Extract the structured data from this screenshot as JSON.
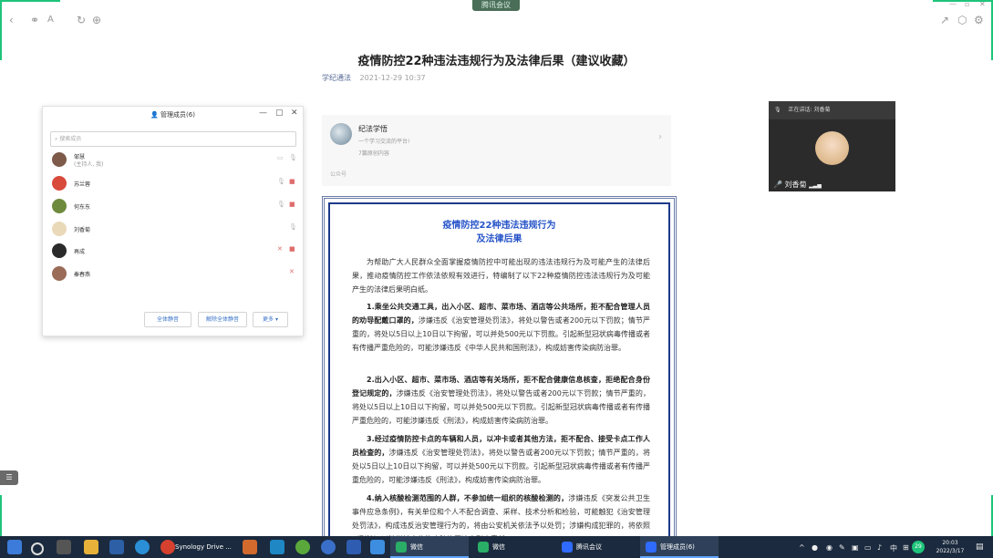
{
  "browser": {
    "meeting_caption": "腾讯会议",
    "icons": [
      "back-icon",
      "link-icon",
      "font-size-icon",
      "refresh-icon",
      "globe-icon",
      "share-icon",
      "cube-icon",
      "settings-icon"
    ]
  },
  "article": {
    "title": "疫情防控22种违法违规行为及法律后果（建议收藏）",
    "account": "学纪通法",
    "date": "2021-12-29 10:37"
  },
  "member_panel": {
    "title": "管理成员(6)",
    "search_placeholder": "搜索成员",
    "members": [
      {
        "name": "邹慧",
        "sub": "(主持人, 我)",
        "avatar_color": "#7d5a4a"
      },
      {
        "name": "苏兰蓉",
        "sub": "",
        "avatar_color": "#d84a3a"
      },
      {
        "name": "何东东",
        "sub": "",
        "avatar_color": "#6e8a3c"
      },
      {
        "name": "刘香菊",
        "sub": "",
        "avatar_color": "#e9d9b8"
      },
      {
        "name": "再成",
        "sub": "",
        "avatar_color": "#2a2a2a"
      },
      {
        "name": "秦春燕",
        "sub": "",
        "avatar_color": "#9a6b57"
      }
    ],
    "buttons": {
      "mute_all": "全体静音",
      "unmute_all": "解除全体静音",
      "more": "更多 ▾"
    }
  },
  "video": {
    "speaking_label": "正在讲话: 刘香菊",
    "name": "刘香菊"
  },
  "account_card": {
    "name": "纪法学悟",
    "desc": "一个学习交流的平台!",
    "count": "7篇原创内容",
    "label": "公众号"
  },
  "notice": {
    "title_line1": "疫情防控22种违法违规行为",
    "title_line2": "及法律后果",
    "intro": "为帮助广大人民群众全面掌握疫情防控中可能出现的违法违规行为及可能产生的法律后果，推动疫情防控工作依法依规有效进行，特编制了以下22种疫情防控违法违规行为及可能产生的法律后果明白纸。",
    "item1_head": "1.乘坐公共交通工具，出入小区、超市、菜市场、酒店等公共场所，拒不配合管理人员的劝导配戴口罩的，",
    "item1_body": "涉嫌违反《治安管理处罚法》，将处以警告或者200元以下罚款；情节严重的，将处以5日以上10日以下拘留，可以并处500元以下罚款。引起新型冠状病毒传播或者有传播严重危险的，可能涉嫌违反《中华人民共和国刑法》，构成妨害传染病防治罪。",
    "item2_head": "2.出入小区、超市、菜市场、酒店等有关场所，拒不配合健康信息核查，拒绝配合身份登记规定的，",
    "item2_body": "涉嫌违反《治安管理处罚法》，将处以警告或者200元以下罚款；情节严重的，将处以5日以上10日以下拘留，可以并处500元以下罚款。引起新型冠状病毒传播或者有传播严重危险的，可能涉嫌违反《刑法》，构成妨害传染病防治罪。",
    "item3_head": "3.经过疫情防控卡点的车辆和人员，以冲卡或者其他方法，拒不配合、接受卡点工作人员检查的，",
    "item3_body": "涉嫌违反《治安管理处罚法》，将处以警告或者200元以下罚款；情节严重的，将处以5日以上10日以下拘留，可以并处500元以下罚款。引起新型冠状病毒传播或者有传播严重危险的，可能涉嫌违反《刑法》，构成妨害传染病防治罪。",
    "item4_head": "4.纳入核酸检测范围的人群，不参加统一组织的核酸检测的，",
    "item4_body": "涉嫌违反《突发公共卫生事件应急条例》，有关单位和个人不配合调查、采样、技术分析和检验，可能触犯《治安管理处罚法》，构成违反治安管理行为的，将由公安机关依法予以处罚；涉嫌构成犯罪的，将依照《刑法》以涉嫌妨害传染病防治罪追究刑事责任。"
  },
  "left_toggle": "☰",
  "taskbar": {
    "apps": [
      {
        "label": "Synology Drive ...",
        "color": "#d6412f"
      },
      {
        "label": "微信",
        "color": "#2aae67"
      },
      {
        "label": "微信",
        "color": "#2aae67"
      },
      {
        "label": "腾讯会议",
        "color": "#2f6bff"
      },
      {
        "label": "管理成员(6)",
        "color": "#2f6bff"
      }
    ],
    "badge": "29",
    "time": "20:03",
    "date": "2022/3/17"
  }
}
